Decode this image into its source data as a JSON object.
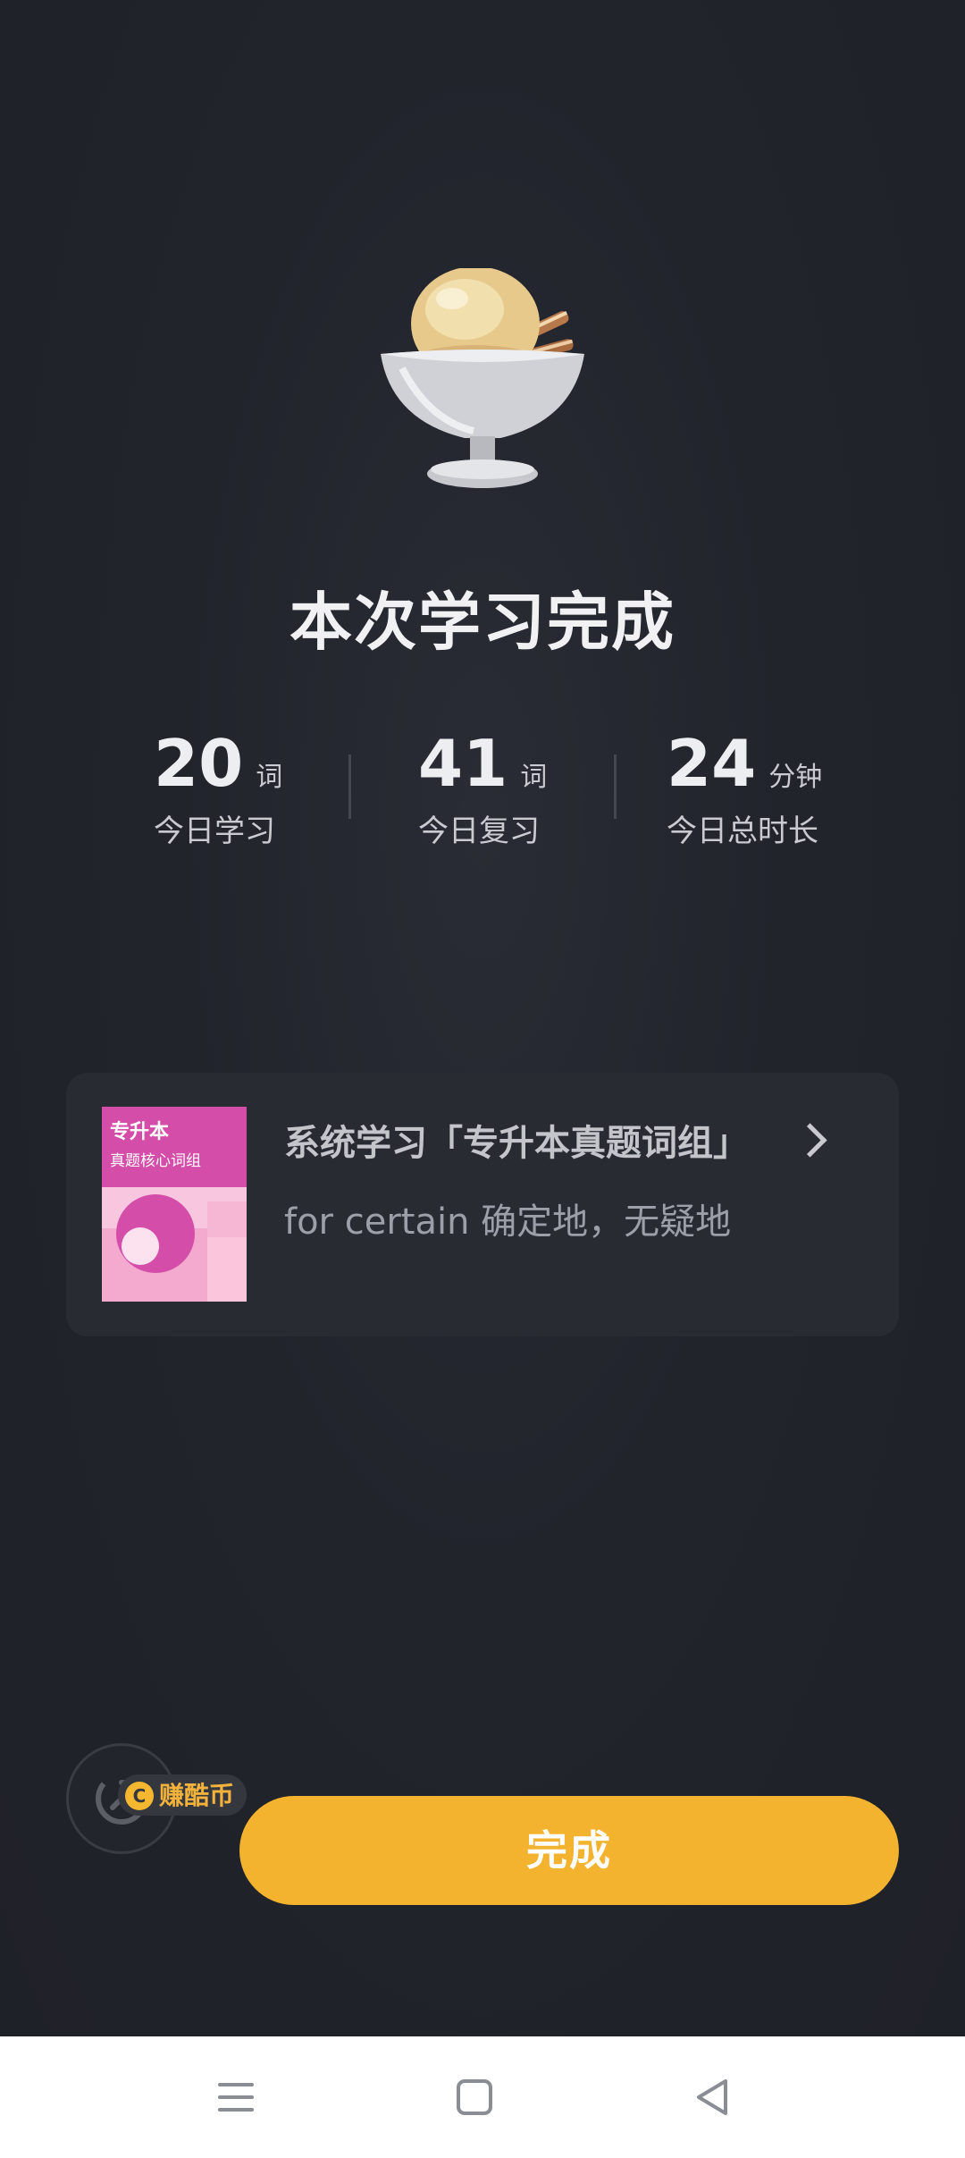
{
  "title": "本次学习完成",
  "stats": [
    {
      "value": "20",
      "unit": "词",
      "label": "今日学习"
    },
    {
      "value": "41",
      "unit": "词",
      "label": "今日复习"
    },
    {
      "value": "24",
      "unit": "分钟",
      "label": "今日总时长"
    }
  ],
  "card": {
    "cover_title": "专升本",
    "cover_subtitle": "真题核心词组",
    "title": "系统学习「专升本真题词组」",
    "subtitle": "for certain 确定地，无疑地"
  },
  "badge": {
    "coin_symbol": "C",
    "label": "赚酷币"
  },
  "done_button": "完成",
  "icons": {
    "hero": "ice-cream-icon",
    "share": "share-icon",
    "nav": [
      "menu-icon",
      "home-icon",
      "back-icon"
    ]
  },
  "colors": {
    "accent": "#f3b32f",
    "background": "#22242c"
  }
}
